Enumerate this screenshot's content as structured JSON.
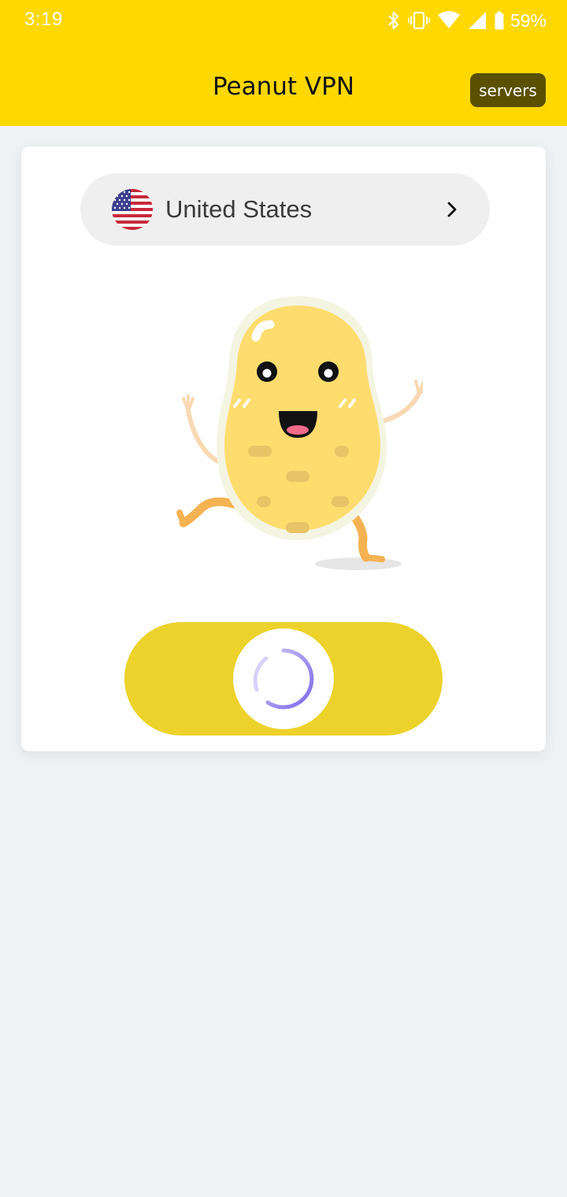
{
  "status_bar": {
    "time": "3:19",
    "battery_percent": "59%",
    "icons": [
      "bluetooth-icon",
      "vibrate-icon",
      "wifi-icon",
      "cell-signal-icon",
      "battery-icon"
    ]
  },
  "app_bar": {
    "title": "Peanut VPN",
    "servers_label": "servers"
  },
  "connection": {
    "country": "United States",
    "flag_icon": "us-flag-icon",
    "state": "connecting"
  },
  "colors": {
    "brand_yellow": "#ffd800",
    "toggle_yellow": "#ecd22a",
    "servers_button_bg": "#5b4f00",
    "spinner_purple": "#7b68e8",
    "background": "#eff2f5"
  }
}
